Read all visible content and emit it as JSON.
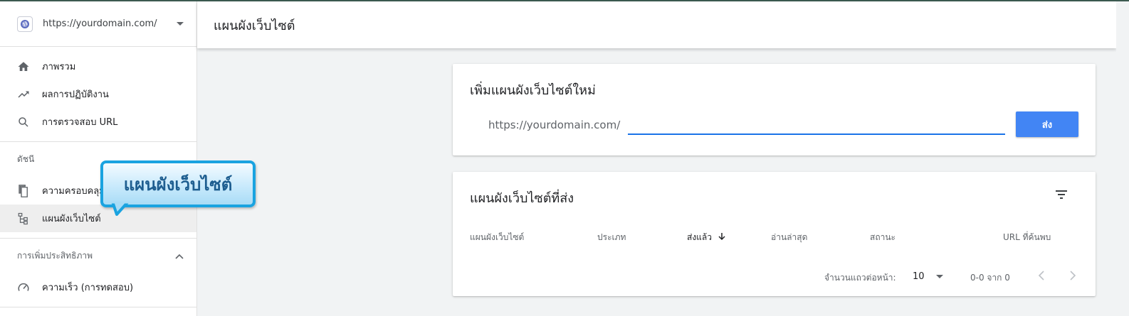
{
  "property": {
    "url": "https://yourdomain.com/"
  },
  "nav": {
    "overview": "ภาพรวม",
    "performance": "ผลการปฏิบัติงาน",
    "url_inspection": "การตรวจสอบ URL",
    "index_section": "ดัชนี",
    "coverage": "ความครอบคลุม",
    "sitemaps": "แผนผังเว็บไซต์",
    "enhancements_section": "การเพิ่มประสิทธิภาพ",
    "speed": "ความเร็ว (การทดสอบ)"
  },
  "topbar": {
    "title": "แผนผังเว็บไซต์"
  },
  "add_sitemap": {
    "title": "เพิ่มแผนผังเว็บไซต์ใหม่",
    "prefix": "https://yourdomain.com/",
    "input_value": "",
    "submit_label": "ส่ง"
  },
  "submitted": {
    "title": "แผนผังเว็บไซต์ที่ส่ง",
    "columns": [
      "แผนผังเว็บไซต์",
      "ประเภท",
      "ส่งแล้ว",
      "อ่านล่าสุด",
      "สถานะ",
      "URL ที่ค้นพบ"
    ],
    "rows_per_page_label": "จำนวนแถวต่อหน้า:",
    "rows_per_page": "10",
    "range": "0-0 จาก 0"
  },
  "callout": {
    "text": "แผนผังเว็บไซต์"
  },
  "colors": {
    "accent": "#4285f4",
    "underline": "#1a73e8",
    "callout_border": "#1aa3e0"
  }
}
